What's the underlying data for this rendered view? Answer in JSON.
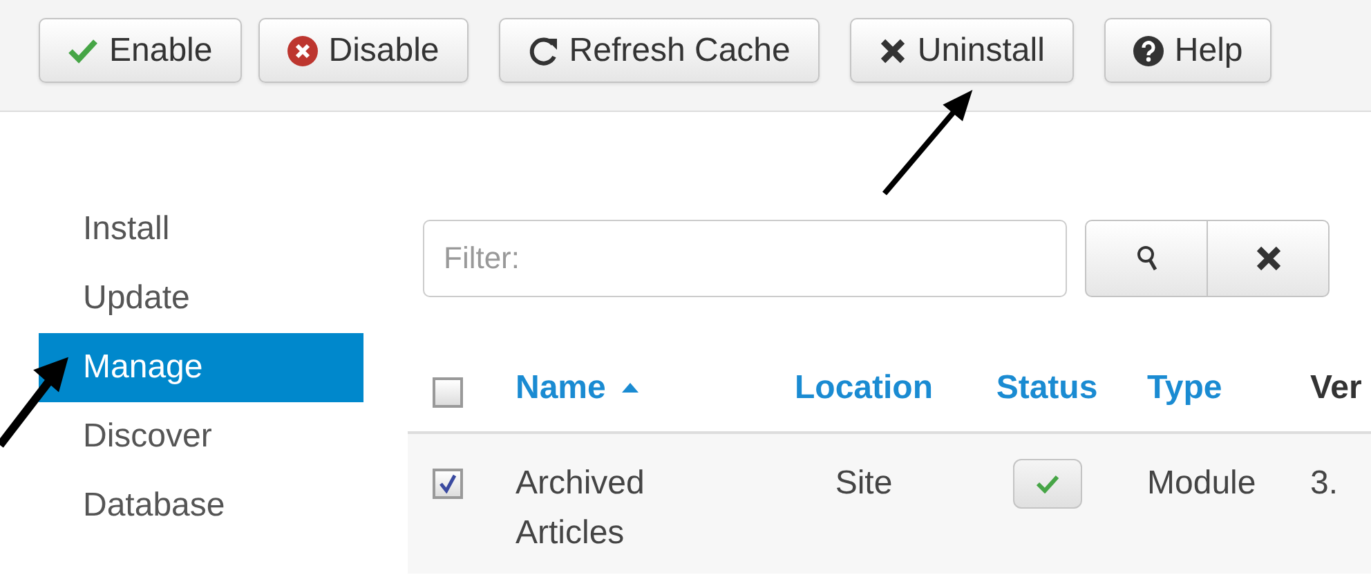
{
  "toolbar": {
    "groups": [
      [
        {
          "label": "Enable",
          "kind": "check"
        },
        {
          "label": "Disable",
          "kind": "error"
        }
      ],
      [
        {
          "label": "Refresh Cache",
          "kind": "refresh"
        }
      ],
      [
        {
          "label": "Uninstall",
          "kind": "times"
        }
      ],
      [
        {
          "label": "Help",
          "kind": "help"
        }
      ]
    ]
  },
  "sidebar": {
    "items": [
      {
        "label": "Install",
        "selected": false
      },
      {
        "label": "Update",
        "selected": false
      },
      {
        "label": "Manage",
        "selected": true
      },
      {
        "label": "Discover",
        "selected": false
      },
      {
        "label": "Database",
        "selected": false
      }
    ]
  },
  "filter": {
    "placeholder": "Filter:"
  },
  "table": {
    "select_all": {
      "checked": false
    },
    "columns": [
      {
        "label": "Name",
        "kind": "link",
        "sorted_ascending": true
      },
      {
        "label": "Location",
        "kind": "link"
      },
      {
        "label": "Status",
        "kind": "link"
      },
      {
        "label": "Type",
        "kind": "link"
      },
      {
        "label": "Ver",
        "kind": "plain"
      }
    ],
    "rows": [
      {
        "checked": true,
        "name": "Archived Articles",
        "location": "Site",
        "enabled": true,
        "type": "Module",
        "column_5": "3."
      }
    ]
  }
}
